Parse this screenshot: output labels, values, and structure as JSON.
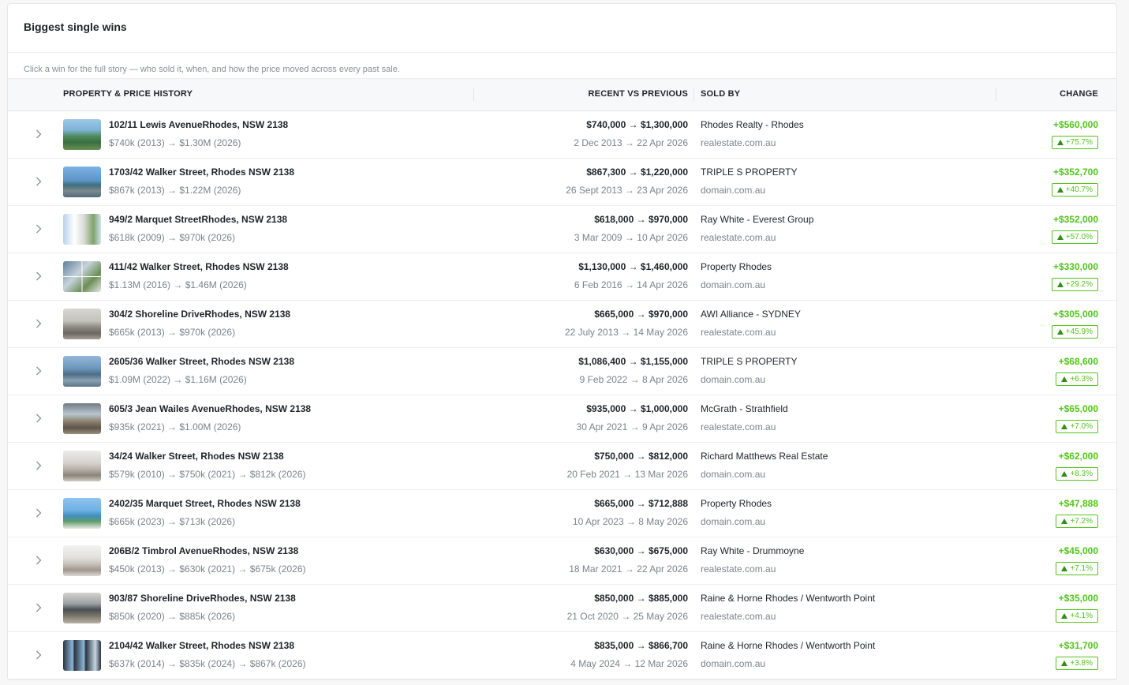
{
  "card": {
    "title": "Biggest single wins",
    "subtitle": "Click a win for the full story — who sold it, when, and how the price moved across every past sale."
  },
  "table": {
    "headers": {
      "property": "PROPERTY & PRICE HISTORY",
      "recent": "RECENT VS PREVIOUS",
      "sold_by": "SOLD BY",
      "change": "CHANGE"
    },
    "rows": [
      {
        "address": "102/11 Lewis AvenueRhodes, NSW 2138",
        "history": "$740k (2013) → $1.30M (2026)",
        "prices": "$740,000 → $1,300,000",
        "dates": "2 Dec 2013 → 22 Apr 2026",
        "agency": "Rhodes Realty - Rhodes",
        "source": "realestate.com.au",
        "change": "+$560,000",
        "pct": "+75.7%",
        "thumb_icon": "property-photo"
      },
      {
        "address": "1703/42 Walker Street, Rhodes NSW 2138",
        "history": "$867k (2013) → $1.22M (2026)",
        "prices": "$867,300 → $1,220,000",
        "dates": "26 Sept 2013 → 23 Apr 2026",
        "agency": "TRIPLE S PROPERTY",
        "source": "domain.com.au",
        "change": "+$352,700",
        "pct": "+40.7%",
        "thumb_icon": "property-photo"
      },
      {
        "address": "949/2 Marquet StreetRhodes, NSW 2138",
        "history": "$618k (2009) → $970k (2026)",
        "prices": "$618,000 → $970,000",
        "dates": "3 Mar 2009 → 10 Apr 2026",
        "agency": "Ray White - Everest Group",
        "source": "realestate.com.au",
        "change": "+$352,000",
        "pct": "+57.0%",
        "thumb_icon": "property-photo"
      },
      {
        "address": "411/42 Walker Street, Rhodes NSW 2138",
        "history": "$1.13M (2016) → $1.46M (2026)",
        "prices": "$1,130,000 → $1,460,000",
        "dates": "6 Feb 2016 → 14 Apr 2026",
        "agency": "Property Rhodes",
        "source": "domain.com.au",
        "change": "+$330,000",
        "pct": "+29.2%",
        "thumb_icon": "property-photo"
      },
      {
        "address": "304/2 Shoreline DriveRhodes, NSW 2138",
        "history": "$665k (2013) → $970k (2026)",
        "prices": "$665,000 → $970,000",
        "dates": "22 July 2013 → 14 May 2026",
        "agency": "AWI Alliance - SYDNEY",
        "source": "realestate.com.au",
        "change": "+$305,000",
        "pct": "+45.9%",
        "thumb_icon": "property-photo"
      },
      {
        "address": "2605/36 Walker Street, Rhodes NSW 2138",
        "history": "$1.09M (2022) → $1.16M (2026)",
        "prices": "$1,086,400 → $1,155,000",
        "dates": "9 Feb 2022 → 8 Apr 2026",
        "agency": "TRIPLE S PROPERTY",
        "source": "domain.com.au",
        "change": "+$68,600",
        "pct": "+6.3%",
        "thumb_icon": "property-photo"
      },
      {
        "address": "605/3 Jean Wailes AvenueRhodes, NSW 2138",
        "history": "$935k (2021) → $1.00M (2026)",
        "prices": "$935,000 → $1,000,000",
        "dates": "30 Apr 2021 → 9 Apr 2026",
        "agency": "McGrath - Strathfield",
        "source": "realestate.com.au",
        "change": "+$65,000",
        "pct": "+7.0%",
        "thumb_icon": "property-photo"
      },
      {
        "address": "34/24 Walker Street, Rhodes NSW 2138",
        "history": "$579k (2010) → $750k (2021) → $812k (2026)",
        "prices": "$750,000 → $812,000",
        "dates": "20 Feb 2021 → 13 Mar 2026",
        "agency": "Richard Matthews Real Estate",
        "source": "domain.com.au",
        "change": "+$62,000",
        "pct": "+8.3%",
        "thumb_icon": "property-photo"
      },
      {
        "address": "2402/35 Marquet Street, Rhodes NSW 2138",
        "history": "$665k (2023) → $713k (2026)",
        "prices": "$665,000 → $712,888",
        "dates": "10 Apr 2023 → 8 May 2026",
        "agency": "Property Rhodes",
        "source": "domain.com.au",
        "change": "+$47,888",
        "pct": "+7.2%",
        "thumb_icon": "property-photo"
      },
      {
        "address": "206B/2 Timbrol AvenueRhodes, NSW 2138",
        "history": "$450k (2013) → $630k (2021) → $675k (2026)",
        "prices": "$630,000 → $675,000",
        "dates": "18 Mar 2021 → 22 Apr 2026",
        "agency": "Ray White - Drummoyne",
        "source": "realestate.com.au",
        "change": "+$45,000",
        "pct": "+7.1%",
        "thumb_icon": "property-photo"
      },
      {
        "address": "903/87 Shoreline DriveRhodes, NSW 2138",
        "history": "$850k (2020) → $885k (2026)",
        "prices": "$850,000 → $885,000",
        "dates": "21 Oct 2020 → 25 May 2026",
        "agency": "Raine & Horne Rhodes / Wentworth Point",
        "source": "realestate.com.au",
        "change": "+$35,000",
        "pct": "+4.1%",
        "thumb_icon": "property-photo"
      },
      {
        "address": "2104/42 Walker Street, Rhodes NSW 2138",
        "history": "$637k (2014) → $835k (2024) → $867k (2026)",
        "prices": "$835,000 → $866,700",
        "dates": "4 May 2024 → 12 Mar 2026",
        "agency": "Raine & Horne Rhodes / Wentworth Point",
        "source": "domain.com.au",
        "change": "+$31,700",
        "pct": "+3.8%",
        "thumb_icon": "property-photo"
      }
    ]
  },
  "colors": {
    "positive": "#52c41a",
    "text": "#1f2329",
    "muted": "#7d828b"
  }
}
